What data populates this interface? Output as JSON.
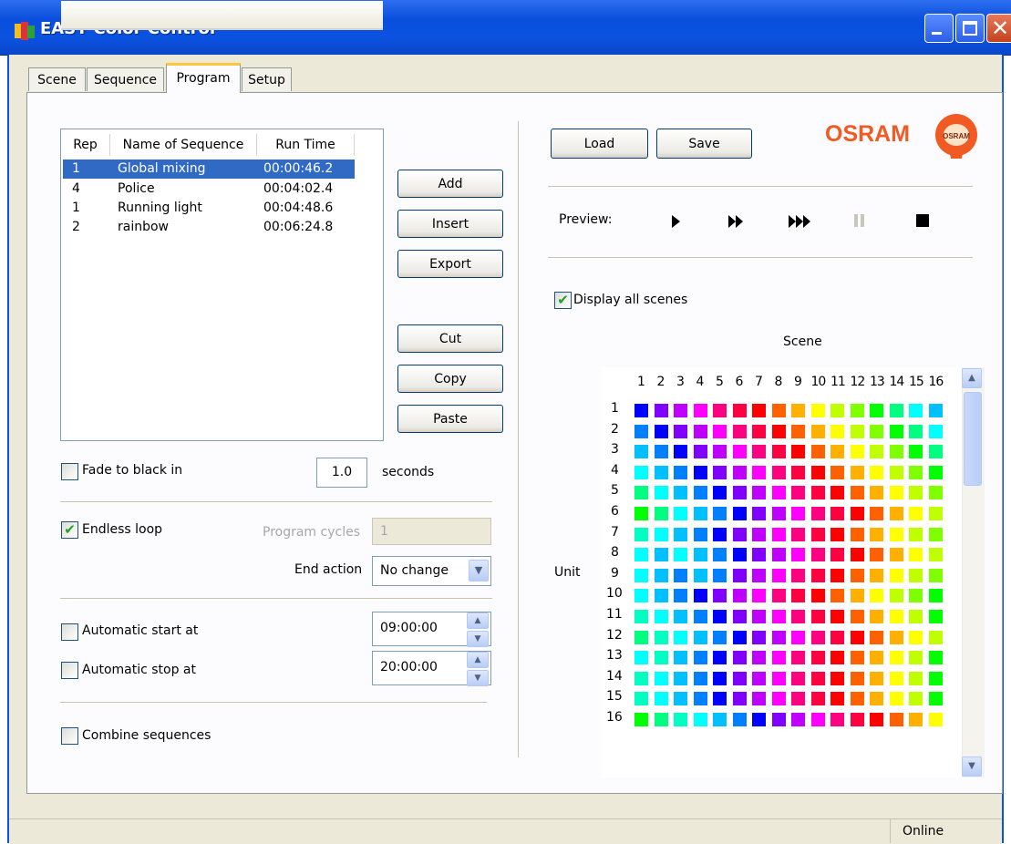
{
  "window": {
    "title": "EASY Color Control",
    "controls": [
      "minimize",
      "maximize",
      "close"
    ]
  },
  "tabs": [
    {
      "label": "Scene",
      "active": false
    },
    {
      "label": "Sequence",
      "active": false
    },
    {
      "label": "Program",
      "active": true
    },
    {
      "label": "Setup",
      "active": false
    }
  ],
  "program": {
    "list_columns": [
      "Rep",
      "Name of Sequence",
      "Run Time"
    ],
    "rows": [
      {
        "rep": "1",
        "name": "Global mixing",
        "time": "00:00:46.2",
        "selected": true
      },
      {
        "rep": "4",
        "name": "Police",
        "time": "00:04:02.4",
        "selected": false
      },
      {
        "rep": "1",
        "name": "Running light",
        "time": "00:04:48.6",
        "selected": false
      },
      {
        "rep": "2",
        "name": "rainbow",
        "time": "00:06:24.8",
        "selected": false
      }
    ],
    "buttons": {
      "add": "Add",
      "insert": "Insert",
      "export": "Export",
      "cut": "Cut",
      "copy": "Copy",
      "paste": "Paste"
    },
    "fade": {
      "label": "Fade to black in",
      "checked": false,
      "value": "1.0",
      "unit": "seconds"
    },
    "endless_loop": {
      "label": "Endless loop",
      "checked": true
    },
    "program_cycles": {
      "label": "Program cycles",
      "value": "1",
      "disabled": true
    },
    "end_action": {
      "label": "End action",
      "value": "No change"
    },
    "auto_start": {
      "label": "Automatic start at",
      "checked": false,
      "value": "09:00:00"
    },
    "auto_stop": {
      "label": "Automatic stop at",
      "checked": false,
      "value": "20:00:00"
    },
    "combine": {
      "label": "Combine sequences",
      "checked": false
    }
  },
  "right": {
    "load_label": "Load",
    "save_label": "Save",
    "logo_text": "OSRAM",
    "bulb_text": "OSRAM",
    "preview_label": "Preview:",
    "preview_controls": [
      "play-icon",
      "fast-forward-icon",
      "faster-forward-icon",
      "pause-icon",
      "stop-icon"
    ],
    "display_all_scenes": {
      "label": "Display all scenes",
      "checked": true
    },
    "grid": {
      "title": "Scene",
      "row_axis_label": "Unit",
      "columns": [
        "1",
        "2",
        "3",
        "4",
        "5",
        "6",
        "7",
        "8",
        "9",
        "10",
        "11",
        "12",
        "13",
        "14",
        "15",
        "16"
      ],
      "rows": [
        "1",
        "2",
        "3",
        "4",
        "5",
        "6",
        "7",
        "8",
        "9",
        "10",
        "11",
        "12",
        "13",
        "14",
        "15",
        "16"
      ],
      "colors": [
        [
          "#0000ff",
          "#8000ff",
          "#c000ff",
          "#ff00ff",
          "#ff0080",
          "#ff0040",
          "#ff0000",
          "#ff6000",
          "#ffb000",
          "#ffff00",
          "#c0ff00",
          "#80ff00",
          "#00ff00",
          "#00ff80",
          "#00ffff",
          "#00c0ff"
        ],
        [
          "#0080ff",
          "#0000ff",
          "#8000ff",
          "#c000ff",
          "#ff00ff",
          "#ff0080",
          "#ff0040",
          "#ff0000",
          "#ff6000",
          "#ffb000",
          "#ffff00",
          "#c0ff00",
          "#80ff00",
          "#00ff00",
          "#00ff80",
          "#00ffff"
        ],
        [
          "#00c0ff",
          "#0080ff",
          "#0000ff",
          "#8000ff",
          "#c000ff",
          "#ff00ff",
          "#ff0080",
          "#ff0040",
          "#ff0000",
          "#ff6000",
          "#ffb000",
          "#ffff00",
          "#c0ff00",
          "#80ff00",
          "#00ff00",
          "#00ff80"
        ],
        [
          "#00ffff",
          "#00c0ff",
          "#0080ff",
          "#0000ff",
          "#8000ff",
          "#c000ff",
          "#ff00ff",
          "#ff0080",
          "#ff0040",
          "#ff0000",
          "#ff6000",
          "#ffb000",
          "#ffff00",
          "#c0ff00",
          "#80ff00",
          "#00ff00"
        ],
        [
          "#00ff80",
          "#00ffff",
          "#00c0ff",
          "#0080ff",
          "#0000ff",
          "#8000ff",
          "#c000ff",
          "#ff00ff",
          "#ff0080",
          "#ff0040",
          "#ff0000",
          "#ff6000",
          "#ffb000",
          "#ffff00",
          "#c0ff00",
          "#80ff00"
        ],
        [
          "#00ff00",
          "#00ff80",
          "#00ffff",
          "#00c0ff",
          "#0080ff",
          "#0000ff",
          "#8000ff",
          "#c000ff",
          "#ff00ff",
          "#ff0080",
          "#ff0040",
          "#ff0000",
          "#ff6000",
          "#ffb000",
          "#ffff00",
          "#c0ff00"
        ],
        [
          "#00ffc0",
          "#00ffff",
          "#00c0ff",
          "#0080ff",
          "#0000ff",
          "#8000ff",
          "#c000ff",
          "#ff00ff",
          "#ff0080",
          "#ff0040",
          "#ff0000",
          "#ff6000",
          "#ffb000",
          "#ffff00",
          "#c0ff00",
          "#80ff00"
        ],
        [
          "#00ffff",
          "#00c0ff",
          "#00ffff",
          "#00c0ff",
          "#0080ff",
          "#0000ff",
          "#8000ff",
          "#c000ff",
          "#ff00ff",
          "#ff0080",
          "#ff0040",
          "#ff0000",
          "#ff6000",
          "#ffb000",
          "#ffff00",
          "#c0ff00"
        ],
        [
          "#00ffff",
          "#00c0ff",
          "#0080ff",
          "#00c0ff",
          "#0080ff",
          "#8000ff",
          "#c000ff",
          "#ff00ff",
          "#ff0080",
          "#ff0040",
          "#ff0000",
          "#ff6000",
          "#ffb000",
          "#ffff00",
          "#c0ff00",
          "#80ff00"
        ],
        [
          "#00ffff",
          "#00c0ff",
          "#0080ff",
          "#0000ff",
          "#8000ff",
          "#c000ff",
          "#ff00ff",
          "#ff0080",
          "#ff0040",
          "#ff0000",
          "#ff6000",
          "#ffb000",
          "#ffff00",
          "#c0ff00",
          "#80ff00",
          "#00ff00"
        ],
        [
          "#00ffc0",
          "#00ffff",
          "#00c0ff",
          "#0080ff",
          "#0000ff",
          "#8000ff",
          "#c000ff",
          "#ff00ff",
          "#ff0080",
          "#ff0040",
          "#ff0000",
          "#ff6000",
          "#ffb000",
          "#ffff00",
          "#c0ff00",
          "#00ff00"
        ],
        [
          "#00ff80",
          "#00ffc0",
          "#00ffff",
          "#00c0ff",
          "#0080ff",
          "#0000ff",
          "#8000ff",
          "#c000ff",
          "#ff00ff",
          "#ff0080",
          "#ff0040",
          "#ff0000",
          "#ff6000",
          "#ffb000",
          "#ffff00",
          "#c0ff00"
        ],
        [
          "#00ffff",
          "#00ffc0",
          "#00c0ff",
          "#0080ff",
          "#0000ff",
          "#8000ff",
          "#c000ff",
          "#ff00ff",
          "#ff0080",
          "#ff0040",
          "#ff0000",
          "#ff6000",
          "#ffb000",
          "#ffff00",
          "#c0ff00",
          "#00ff00"
        ],
        [
          "#00ffc0",
          "#00ffff",
          "#00c0ff",
          "#0080ff",
          "#0000ff",
          "#8000ff",
          "#c000ff",
          "#ff00ff",
          "#ff0080",
          "#ff0040",
          "#ff0000",
          "#ff6000",
          "#ffb000",
          "#ffff00",
          "#c0ff00",
          "#00ff00"
        ],
        [
          "#00ffc0",
          "#00ffff",
          "#00c0ff",
          "#0080ff",
          "#0000ff",
          "#8000ff",
          "#c000ff",
          "#ff00ff",
          "#ff0080",
          "#ff0040",
          "#ff0000",
          "#ff6000",
          "#ffb000",
          "#ffff00",
          "#c0ff00",
          "#00ff00"
        ],
        [
          "#00ff00",
          "#00ff80",
          "#00ffc0",
          "#00ffff",
          "#00c0ff",
          "#0080ff",
          "#0000ff",
          "#8000ff",
          "#c000ff",
          "#ff00ff",
          "#ff0080",
          "#ff0040",
          "#ff0000",
          "#ff6000",
          "#ffb000",
          "#ffff00"
        ]
      ]
    }
  },
  "status": {
    "text": "Online"
  },
  "theme": {
    "accent": "#0b52e0",
    "selection": "#316ac5",
    "osram_orange": "#f15a22"
  }
}
